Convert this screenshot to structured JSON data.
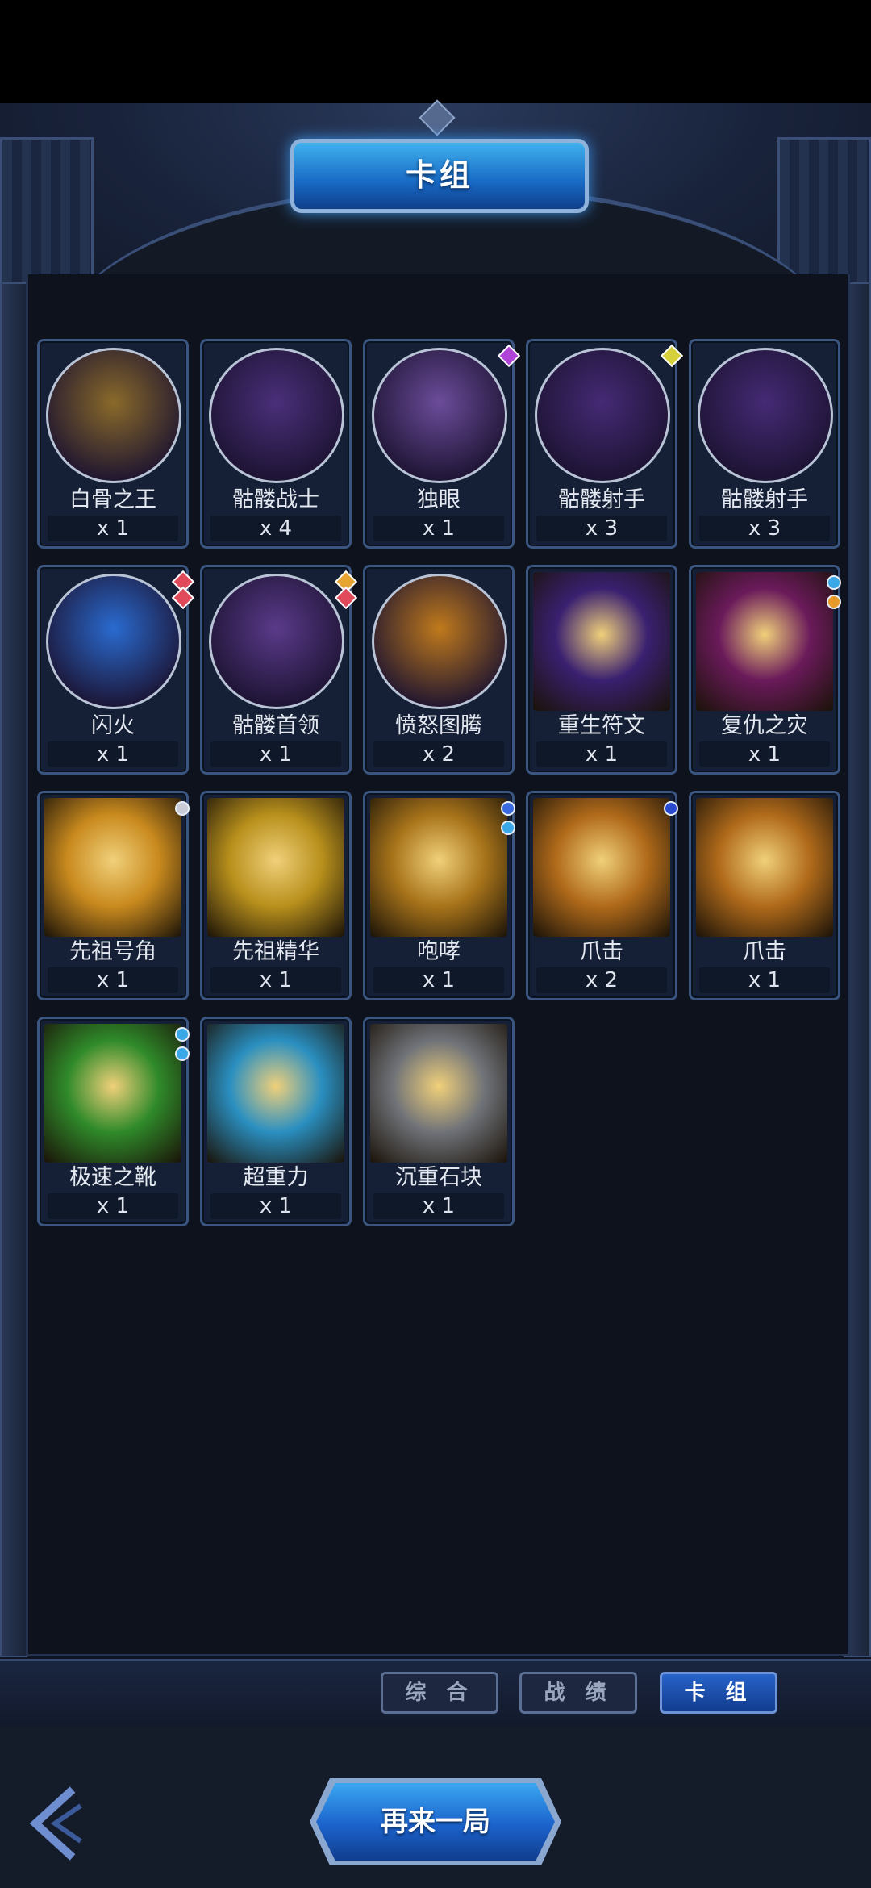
{
  "title": "卡组",
  "tabs": [
    {
      "label": "综 合",
      "active": false
    },
    {
      "label": "战 绩",
      "active": false
    },
    {
      "label": "卡 组",
      "active": true
    }
  ],
  "play_again_label": "再来一局",
  "back_icon": "chevron-left-icon",
  "cards": [
    {
      "name": "白骨之王",
      "count": "x 1",
      "kind": "unit",
      "art": "#8a6a2a",
      "badges": []
    },
    {
      "name": "骷髅战士",
      "count": "x 4",
      "kind": "unit",
      "art": "#4a2f7a",
      "badges": []
    },
    {
      "name": "独眼",
      "count": "x 1",
      "kind": "unit",
      "art": "#6b4c9a",
      "badges": [
        {
          "shape": "diamond",
          "color": "#b044d8"
        }
      ]
    },
    {
      "name": "骷髅射手",
      "count": "x 3",
      "kind": "unit",
      "art": "#452a75",
      "badges": [
        {
          "shape": "diamond",
          "color": "#d6d03a"
        }
      ]
    },
    {
      "name": "骷髅射手",
      "count": "x 3",
      "kind": "unit",
      "art": "#452a75",
      "badges": []
    },
    {
      "name": "闪火",
      "count": "x 1",
      "kind": "unit",
      "art": "#2a6bd0",
      "badges": [
        {
          "shape": "diamond",
          "color": "#e04a5a"
        },
        {
          "shape": "diamond",
          "color": "#e04a5a"
        }
      ]
    },
    {
      "name": "骷髅首领",
      "count": "x 1",
      "kind": "unit",
      "art": "#5a3a8a",
      "badges": [
        {
          "shape": "diamond",
          "color": "#e6a530"
        },
        {
          "shape": "diamond",
          "color": "#e04a5a"
        }
      ]
    },
    {
      "name": "愤怒图腾",
      "count": "x 2",
      "kind": "unit",
      "art": "#c07a1c",
      "badges": []
    },
    {
      "name": "重生符文",
      "count": "x 1",
      "kind": "spell",
      "art": "#3a2070",
      "badges": []
    },
    {
      "name": "复仇之灾",
      "count": "x 1",
      "kind": "spell",
      "art": "#6a1a5a",
      "badges": [
        {
          "shape": "dot",
          "color": "#3aa8e8"
        },
        {
          "shape": "dot",
          "color": "#e69a2a"
        }
      ]
    },
    {
      "name": "先祖号角",
      "count": "x 1",
      "kind": "spell",
      "art": "#c98a1e",
      "badges": [
        {
          "shape": "dot",
          "color": "#c9ccd6"
        }
      ]
    },
    {
      "name": "先祖精华",
      "count": "x 1",
      "kind": "spell",
      "art": "#b8901c",
      "badges": []
    },
    {
      "name": "咆哮",
      "count": "x 1",
      "kind": "spell",
      "art": "#a8741a",
      "badges": [
        {
          "shape": "dot",
          "color": "#3a6ae0"
        },
        {
          "shape": "dot",
          "color": "#3aa8e8"
        }
      ]
    },
    {
      "name": "爪击",
      "count": "x 2",
      "kind": "spell",
      "art": "#b06a1a",
      "badges": [
        {
          "shape": "dot",
          "color": "#2a4ad0"
        }
      ]
    },
    {
      "name": "爪击",
      "count": "x 1",
      "kind": "spell",
      "art": "#b06a1a",
      "badges": []
    },
    {
      "name": "极速之靴",
      "count": "x 1",
      "kind": "spell",
      "art": "#2f8a2a",
      "badges": [
        {
          "shape": "dot",
          "color": "#3aa8e8"
        },
        {
          "shape": "dot",
          "color": "#3aa8e8"
        }
      ]
    },
    {
      "name": "超重力",
      "count": "x 1",
      "kind": "spell",
      "art": "#2a8fc0",
      "badges": []
    },
    {
      "name": "沉重石块",
      "count": "x 1",
      "kind": "spell",
      "art": "#6f7278",
      "badges": []
    }
  ]
}
